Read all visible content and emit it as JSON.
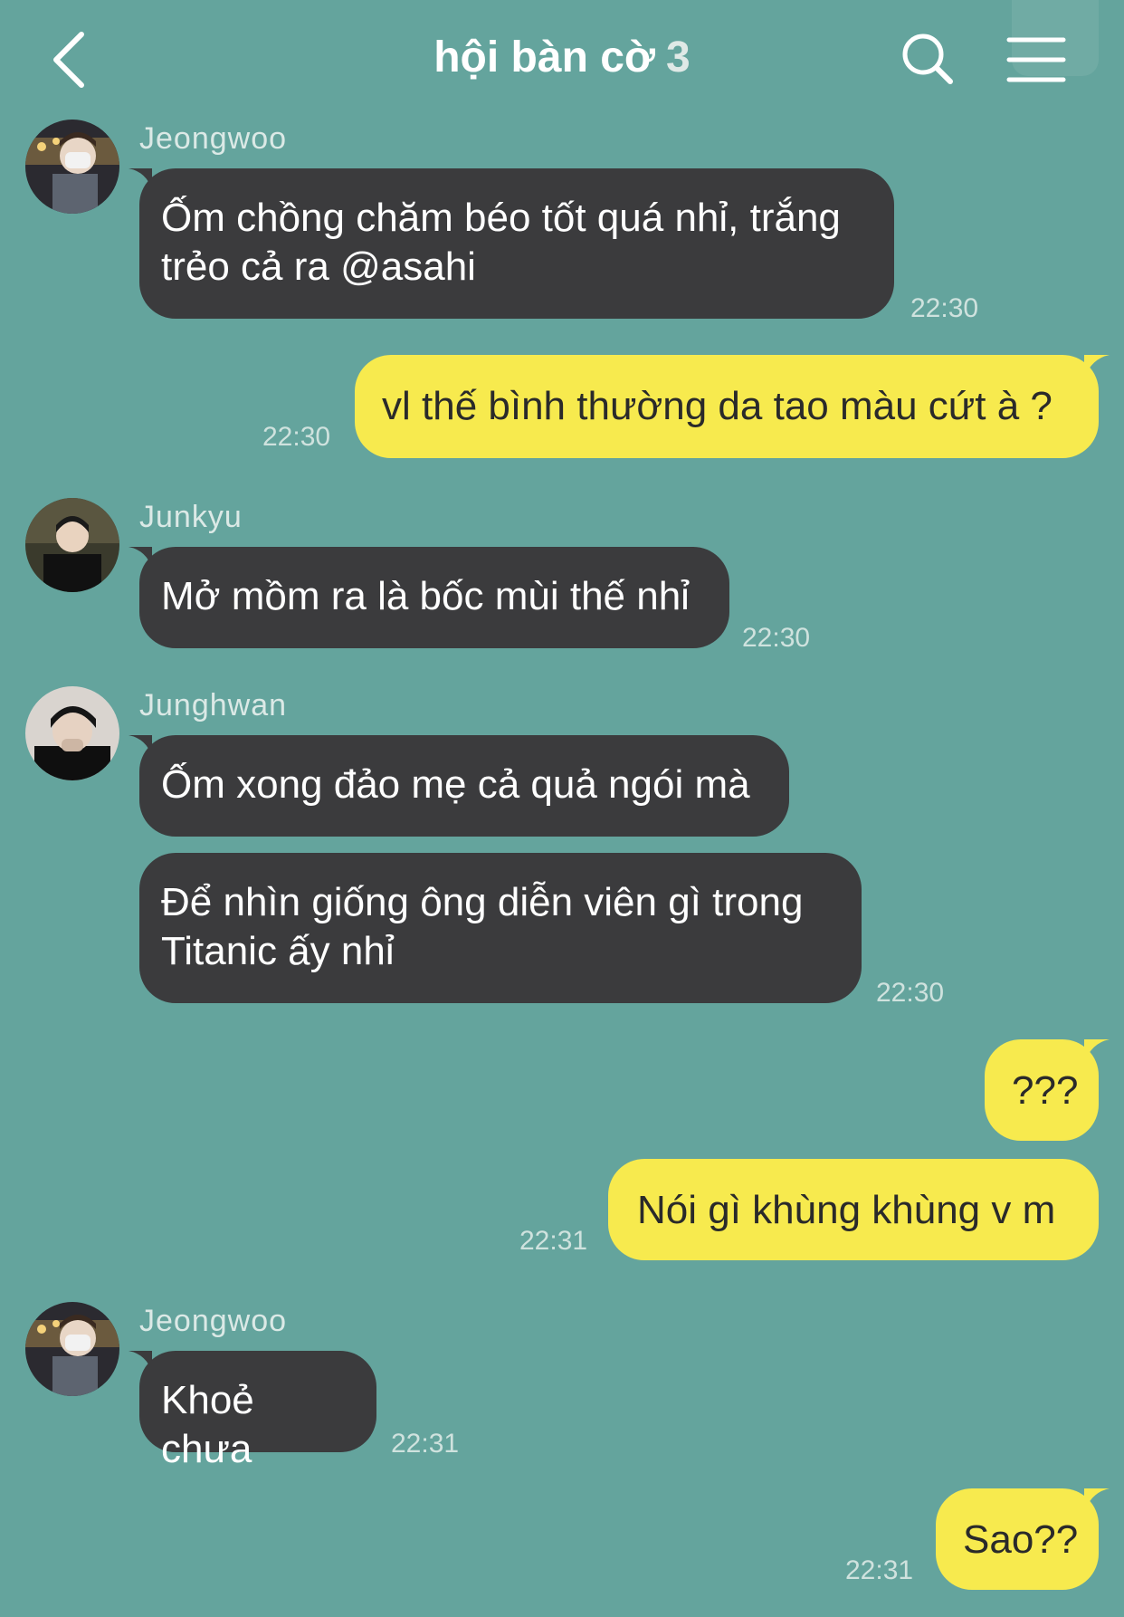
{
  "header": {
    "title": "hội bàn cờ",
    "member_count": "3"
  },
  "messages": [
    {
      "sender": "Jeongwoo",
      "text": "Ốm chồng chăm béo tốt quá nhỉ, trắng\ntrẻo cả ra @asahi",
      "time": "22:30"
    },
    {
      "sender": "",
      "text": "vl thế bình thường da tao màu cứt à ?",
      "time": "22:30"
    },
    {
      "sender": "Junkyu",
      "text": "Mở mồm ra là bốc mùi thế nhỉ",
      "time": "22:30"
    },
    {
      "sender": "Junghwan",
      "text": "Ốm xong đảo mẹ cả quả ngói mà",
      "time": ""
    },
    {
      "sender": "",
      "text": "Để nhìn giống ông diễn viên gì trong\nTitanic ấy nhỉ",
      "time": "22:30"
    },
    {
      "sender": "",
      "text": "???",
      "time": ""
    },
    {
      "sender": "",
      "text": "Nói gì khùng khùng v m",
      "time": "22:31"
    },
    {
      "sender": "Jeongwoo",
      "text": "Khoẻ chưa",
      "time": "22:31"
    },
    {
      "sender": "",
      "text": "Sao??",
      "time": "22:31"
    }
  ],
  "colors": {
    "background": "#64a49d",
    "incoming_bubble": "#3b3b3d",
    "outgoing_bubble": "#f7ea4e"
  },
  "icons": [
    "chevron-left-icon",
    "search-icon",
    "menu-icon"
  ]
}
